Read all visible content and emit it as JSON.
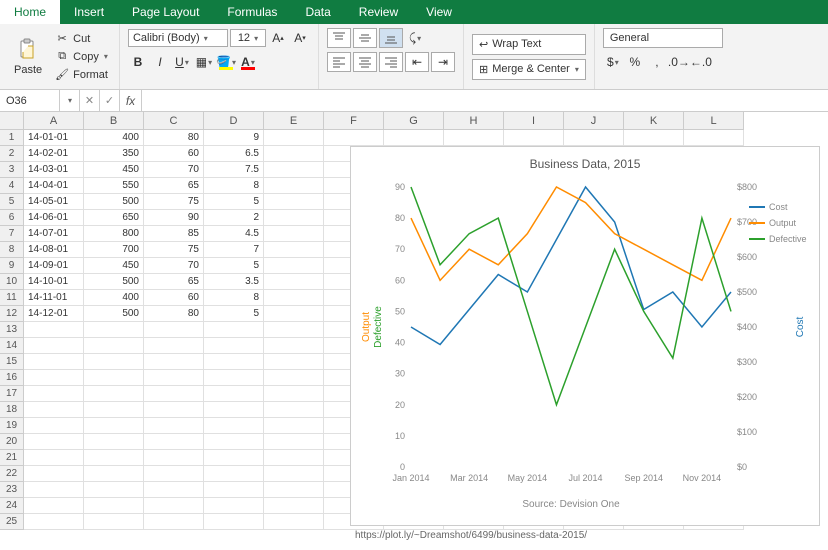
{
  "ribbon": {
    "tabs": [
      "Home",
      "Insert",
      "Page Layout",
      "Formulas",
      "Data",
      "Review",
      "View"
    ],
    "active_tab": "Home",
    "paste_label": "Paste",
    "cut_label": "Cut",
    "copy_label": "Copy",
    "format_label": "Format",
    "font_name": "Calibri (Body)",
    "font_size": "12",
    "wrap_text": "Wrap Text",
    "merge_center": "Merge & Center",
    "number_format": "General"
  },
  "formula_bar": {
    "name_box": "O36",
    "fx": "fx",
    "formula": ""
  },
  "columns": [
    "A",
    "B",
    "C",
    "D",
    "E",
    "F",
    "G",
    "H",
    "I",
    "J",
    "K",
    "L"
  ],
  "row_count": 25,
  "table": [
    {
      "a": "14-01-01",
      "b": 400,
      "c": 80,
      "d": 9
    },
    {
      "a": "14-02-01",
      "b": 350,
      "c": 60,
      "d": 6.5
    },
    {
      "a": "14-03-01",
      "b": 450,
      "c": 70,
      "d": 7.5
    },
    {
      "a": "14-04-01",
      "b": 550,
      "c": 65,
      "d": 8
    },
    {
      "a": "14-05-01",
      "b": 500,
      "c": 75,
      "d": 5
    },
    {
      "a": "14-06-01",
      "b": 650,
      "c": 90,
      "d": 2
    },
    {
      "a": "14-07-01",
      "b": 800,
      "c": 85,
      "d": 4.5
    },
    {
      "a": "14-08-01",
      "b": 700,
      "c": 75,
      "d": 7
    },
    {
      "a": "14-09-01",
      "b": 450,
      "c": 70,
      "d": 5
    },
    {
      "a": "14-10-01",
      "b": 500,
      "c": 65,
      "d": 3.5
    },
    {
      "a": "14-11-01",
      "b": 400,
      "c": 60,
      "d": 8
    },
    {
      "a": "14-12-01",
      "b": 500,
      "c": 80,
      "d": 5
    }
  ],
  "chart_data": {
    "type": "line",
    "title": "Business Data, 2015",
    "x_categories": [
      "Jan 2014",
      "Mar 2014",
      "May 2014",
      "Jul 2014",
      "Sep 2014",
      "Nov 2014"
    ],
    "left_axis": {
      "labels": [
        0,
        10,
        20,
        30,
        40,
        50,
        60,
        70,
        80,
        90
      ],
      "title_top": "Output",
      "title_bottom": "Defective"
    },
    "right_axis": {
      "labels": [
        "$0",
        "$100",
        "$200",
        "$300",
        "$400",
        "$500",
        "$600",
        "$700",
        "$800"
      ],
      "title": "Cost"
    },
    "source": "Source: Devision One",
    "series": [
      {
        "name": "Cost",
        "axis": "right",
        "color": "#1f77b4",
        "values": [
          400,
          350,
          450,
          550,
          500,
          650,
          800,
          700,
          450,
          500,
          400,
          500
        ]
      },
      {
        "name": "Output",
        "axis": "left",
        "color": "#ff8c00",
        "scale": 10,
        "values": [
          80,
          60,
          70,
          65,
          75,
          90,
          85,
          75,
          70,
          65,
          60,
          80
        ]
      },
      {
        "name": "Defective",
        "axis": "left",
        "color": "#2ca02c",
        "scale": 1,
        "values": [
          9,
          6.5,
          7.5,
          8,
          5,
          2,
          4.5,
          7,
          5,
          3.5,
          8,
          5
        ]
      }
    ],
    "legend": [
      "Cost",
      "Output",
      "Defective"
    ]
  },
  "footer_url": "https://plot.ly/~Dreamshot/6499/business-data-2015/"
}
